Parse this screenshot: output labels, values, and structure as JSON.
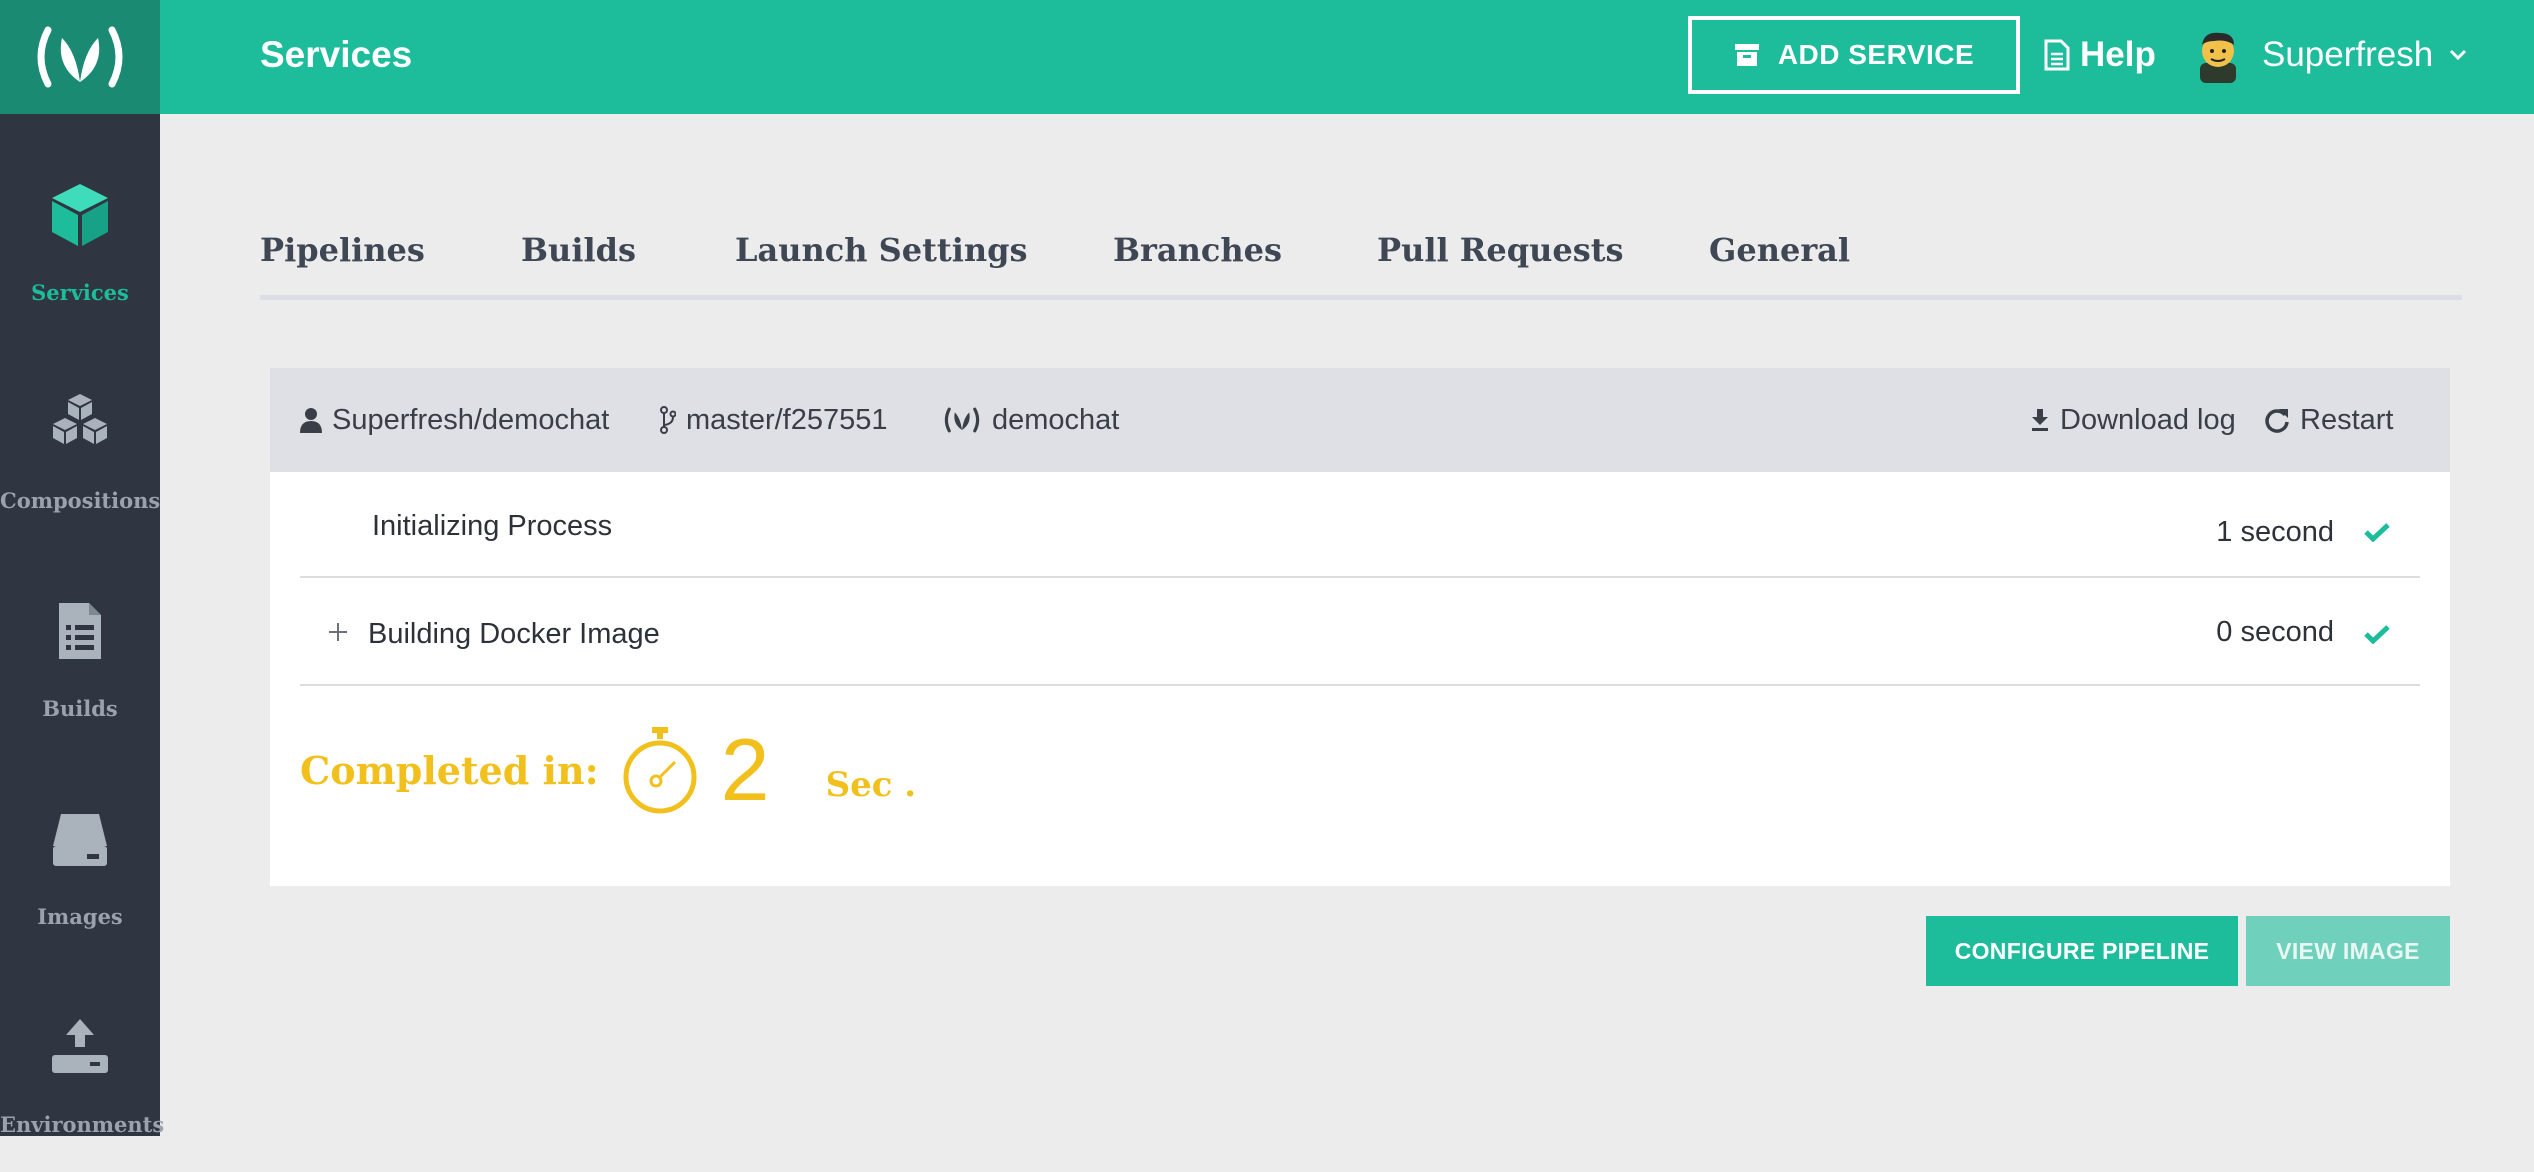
{
  "header": {
    "title": "Services",
    "add_service_label": "ADD SERVICE",
    "help_label": "Help",
    "user_name": "Superfresh"
  },
  "sidebar": {
    "items": [
      {
        "label": "Services",
        "icon": "cube-icon",
        "active": true
      },
      {
        "label": "Compositions",
        "icon": "cubes-icon",
        "active": false
      },
      {
        "label": "Builds",
        "icon": "document-list-icon",
        "active": false
      },
      {
        "label": "Images",
        "icon": "hard-drive-icon",
        "active": false
      },
      {
        "label": "Environments",
        "icon": "upload-icon",
        "active": false
      }
    ]
  },
  "tabs": [
    {
      "label": "Pipelines"
    },
    {
      "label": "Builds"
    },
    {
      "label": "Launch Settings"
    },
    {
      "label": "Branches"
    },
    {
      "label": "Pull Requests"
    },
    {
      "label": "General"
    }
  ],
  "build": {
    "repo": "Superfresh/demochat",
    "branch": "master/f257551",
    "service": "demochat",
    "download_log_label": "Download log",
    "restart_label": "Restart",
    "steps": [
      {
        "label": "Initializing Process",
        "time": "1 second",
        "status": "success"
      },
      {
        "label": "Building Docker Image",
        "time": "0 second",
        "status": "success",
        "expandable": true
      }
    ],
    "completed_label": "Completed in:",
    "completed_value": "2",
    "completed_unit": "Sec ."
  },
  "actions": {
    "configure_label": "CONFIGURE PIPELINE",
    "view_image_label": "VIEW IMAGE"
  },
  "colors": {
    "accent": "#1dbc9b",
    "sidebar": "#2f3641",
    "completed": "#f2c01d"
  }
}
